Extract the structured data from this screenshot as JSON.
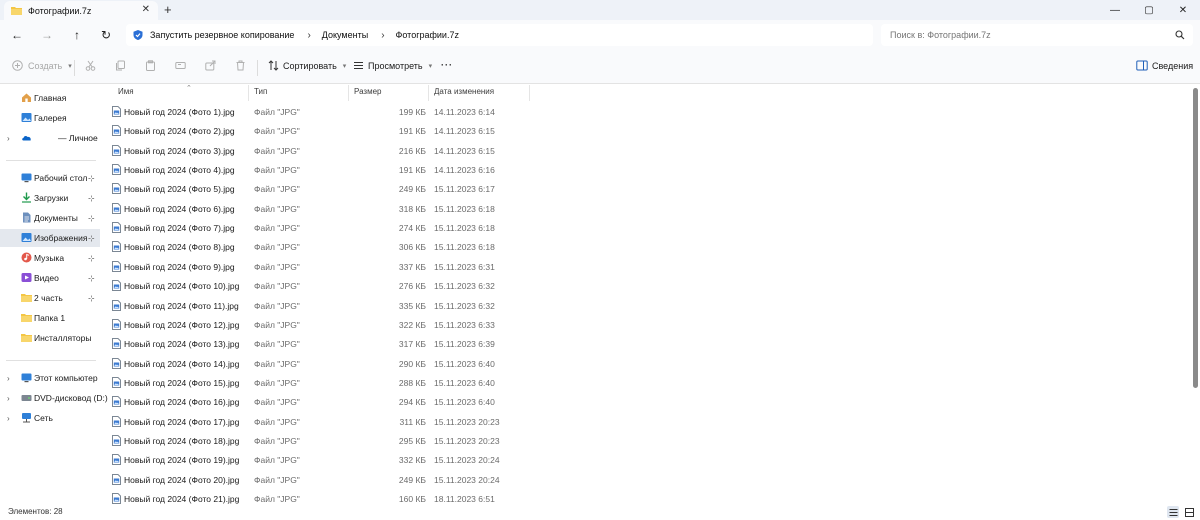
{
  "tab": {
    "title": "Фотографии.7z",
    "close": "✕",
    "new_tab": "+"
  },
  "window_controls": {
    "minimize": "—",
    "maximize": "▢",
    "close": "✕"
  },
  "nav": {
    "back": "←",
    "forward": "→",
    "up": "↑",
    "refresh": "↻"
  },
  "breadcrumb": {
    "backup_label": "Запустить резервное копирование",
    "items": [
      "Документы",
      "Фотографии.7z"
    ],
    "separator": "›"
  },
  "search": {
    "placeholder": "Поиск в: Фотографии.7z"
  },
  "toolbar": {
    "create": "Создать",
    "sort": "Сортировать",
    "view": "Просмотреть",
    "more": "···",
    "details": "Сведения"
  },
  "sidebar": {
    "items": [
      {
        "label": "Главная",
        "icon": "home-icon"
      },
      {
        "label": "Галерея",
        "icon": "gallery-icon"
      },
      {
        "label": "— Личное",
        "icon": "onedrive-icon"
      },
      {
        "label": "Рабочий стол",
        "icon": "desktop-icon"
      },
      {
        "label": "Загрузки",
        "icon": "downloads-icon"
      },
      {
        "label": "Документы",
        "icon": "documents-icon"
      },
      {
        "label": "Изображения",
        "icon": "pictures-icon"
      },
      {
        "label": "Музыка",
        "icon": "music-icon"
      },
      {
        "label": "Видео",
        "icon": "video-icon"
      },
      {
        "label": "2 часть",
        "icon": "folder-icon"
      },
      {
        "label": "Папка 1",
        "icon": "folder-icon"
      },
      {
        "label": "Инсталляторы",
        "icon": "folder-icon"
      },
      {
        "label": "Этот компьютер",
        "icon": "computer-icon"
      },
      {
        "label": "DVD-дисковод (D:)",
        "icon": "dvd-icon"
      },
      {
        "label": "Сеть",
        "icon": "network-icon"
      }
    ],
    "pin": "📌",
    "expander": "›"
  },
  "columns": {
    "name": "Имя",
    "type": "Тип",
    "size": "Размер",
    "date": "Дата изменения"
  },
  "files": [
    {
      "name": "Новый год 2024 (Фото 1).jpg",
      "type": "Файл \"JPG\"",
      "size": "199 КБ",
      "date": "14.11.2023 6:14"
    },
    {
      "name": "Новый год 2024 (Фото 2).jpg",
      "type": "Файл \"JPG\"",
      "size": "191 КБ",
      "date": "14.11.2023 6:15"
    },
    {
      "name": "Новый год 2024 (Фото 3).jpg",
      "type": "Файл \"JPG\"",
      "size": "216 КБ",
      "date": "14.11.2023 6:15"
    },
    {
      "name": "Новый год 2024 (Фото 4).jpg",
      "type": "Файл \"JPG\"",
      "size": "191 КБ",
      "date": "14.11.2023 6:16"
    },
    {
      "name": "Новый год 2024 (Фото 5).jpg",
      "type": "Файл \"JPG\"",
      "size": "249 КБ",
      "date": "15.11.2023 6:17"
    },
    {
      "name": "Новый год 2024 (Фото 6).jpg",
      "type": "Файл \"JPG\"",
      "size": "318 КБ",
      "date": "15.11.2023 6:18"
    },
    {
      "name": "Новый год 2024 (Фото 7).jpg",
      "type": "Файл \"JPG\"",
      "size": "274 КБ",
      "date": "15.11.2023 6:18"
    },
    {
      "name": "Новый год 2024 (Фото 8).jpg",
      "type": "Файл \"JPG\"",
      "size": "306 КБ",
      "date": "15.11.2023 6:18"
    },
    {
      "name": "Новый год 2024 (Фото 9).jpg",
      "type": "Файл \"JPG\"",
      "size": "337 КБ",
      "date": "15.11.2023 6:31"
    },
    {
      "name": "Новый год 2024 (Фото 10).jpg",
      "type": "Файл \"JPG\"",
      "size": "276 КБ",
      "date": "15.11.2023 6:32"
    },
    {
      "name": "Новый год 2024 (Фото 11).jpg",
      "type": "Файл \"JPG\"",
      "size": "335 КБ",
      "date": "15.11.2023 6:32"
    },
    {
      "name": "Новый год 2024 (Фото 12).jpg",
      "type": "Файл \"JPG\"",
      "size": "322 КБ",
      "date": "15.11.2023 6:33"
    },
    {
      "name": "Новый год 2024 (Фото 13).jpg",
      "type": "Файл \"JPG\"",
      "size": "317 КБ",
      "date": "15.11.2023 6:39"
    },
    {
      "name": "Новый год 2024 (Фото 14).jpg",
      "type": "Файл \"JPG\"",
      "size": "290 КБ",
      "date": "15.11.2023 6:40"
    },
    {
      "name": "Новый год 2024 (Фото 15).jpg",
      "type": "Файл \"JPG\"",
      "size": "288 КБ",
      "date": "15.11.2023 6:40"
    },
    {
      "name": "Новый год 2024 (Фото 16).jpg",
      "type": "Файл \"JPG\"",
      "size": "294 КБ",
      "date": "15.11.2023 6:40"
    },
    {
      "name": "Новый год 2024 (Фото 17).jpg",
      "type": "Файл \"JPG\"",
      "size": "311 КБ",
      "date": "15.11.2023 20:23"
    },
    {
      "name": "Новый год 2024 (Фото 18).jpg",
      "type": "Файл \"JPG\"",
      "size": "295 КБ",
      "date": "15.11.2023 20:23"
    },
    {
      "name": "Новый год 2024 (Фото 19).jpg",
      "type": "Файл \"JPG\"",
      "size": "332 КБ",
      "date": "15.11.2023 20:24"
    },
    {
      "name": "Новый год 2024 (Фото 20).jpg",
      "type": "Файл \"JPG\"",
      "size": "249 КБ",
      "date": "15.11.2023 20:24"
    },
    {
      "name": "Новый год 2024 (Фото 21).jpg",
      "type": "Файл \"JPG\"",
      "size": "160 КБ",
      "date": "18.11.2023 6:51"
    }
  ],
  "status": {
    "count": "Элементов: 28"
  },
  "colors": {
    "accent": "#0067c0",
    "folder": "#f4c644",
    "selected": "#e4e8ee"
  }
}
